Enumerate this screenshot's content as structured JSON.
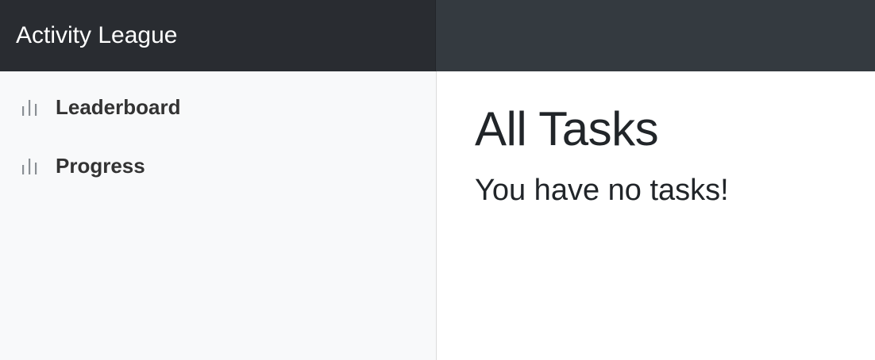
{
  "header": {
    "brand": "Activity League"
  },
  "sidebar": {
    "items": [
      {
        "label": "Leaderboard",
        "icon": "bar-chart-icon"
      },
      {
        "label": "Progress",
        "icon": "bar-chart-icon"
      }
    ]
  },
  "main": {
    "title": "All Tasks",
    "empty_message": "You have no tasks!"
  },
  "colors": {
    "topbar": "#343a40",
    "brand_bg": "#292c31",
    "sidebar_bg": "#f8f9fa",
    "text": "#212529",
    "icon": "#8a8f94"
  }
}
